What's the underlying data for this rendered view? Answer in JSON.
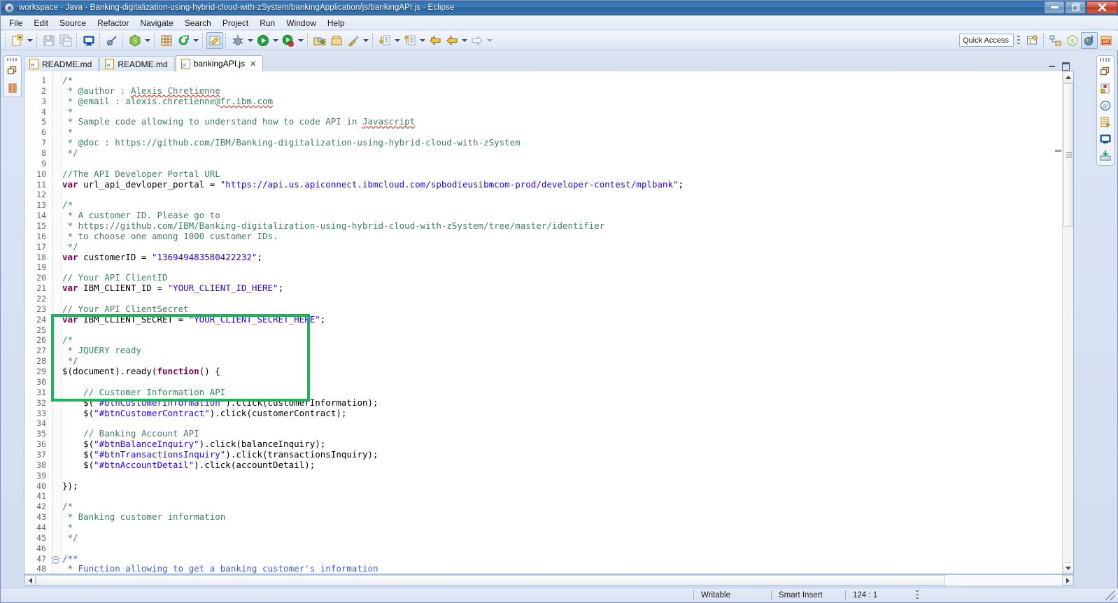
{
  "window": {
    "title": "workspace - Java - Banking-digitalization-using-hybrid-cloud-with-zSystem/bankingApplication/js/bankingAPI.js - Eclipse",
    "minimize_label": "—",
    "maximize_label": "❐",
    "close_label": "✕"
  },
  "menubar": {
    "items": [
      {
        "label": "File"
      },
      {
        "label": "Edit"
      },
      {
        "label": "Source"
      },
      {
        "label": "Refactor"
      },
      {
        "label": "Navigate"
      },
      {
        "label": "Search"
      },
      {
        "label": "Project"
      },
      {
        "label": "Run"
      },
      {
        "label": "Window"
      },
      {
        "label": "Help"
      }
    ]
  },
  "toolbar": {
    "quick_access_placeholder": "Quick Access",
    "buttons": [
      {
        "name": "new-wizard-icon",
        "title": "New"
      },
      {
        "name": "save-icon",
        "title": "Save"
      },
      {
        "name": "save-all-icon",
        "title": "Save All"
      },
      {
        "name": "console-icon",
        "title": "Open Console"
      },
      {
        "name": "skip-breakpoints-icon",
        "title": "Skip All Breakpoints"
      },
      {
        "name": "node-js-icon",
        "title": "Run Node.js"
      },
      {
        "name": "new-package-icon",
        "title": "New Java Package"
      },
      {
        "name": "refresh-icon",
        "title": "Refresh"
      },
      {
        "name": "marker-icon",
        "title": "Toggle Mark Occurrences"
      },
      {
        "name": "debug-icon",
        "title": "Debug"
      },
      {
        "name": "run-icon",
        "title": "Run"
      },
      {
        "name": "coverage-icon",
        "title": "Coverage"
      },
      {
        "name": "open-type-icon",
        "title": "Open Type"
      },
      {
        "name": "open-task-icon",
        "title": "Open Task"
      },
      {
        "name": "external-tools-icon",
        "title": "External Tools"
      },
      {
        "name": "next-annotation-icon",
        "title": "Next Annotation"
      },
      {
        "name": "previous-annotation-icon",
        "title": "Previous Annotation"
      },
      {
        "name": "back-icon",
        "title": "Back"
      },
      {
        "name": "forward-icon",
        "title": "Forward"
      }
    ],
    "perspectives": [
      {
        "name": "open-perspective-icon",
        "title": "Open Perspective"
      },
      {
        "name": "java-ee-perspective-icon",
        "title": "Java EE"
      },
      {
        "name": "javascript-perspective-icon",
        "title": "JavaScript"
      },
      {
        "name": "java-perspective-icon",
        "title": "Java",
        "active": true
      },
      {
        "name": "git-perspective-icon",
        "title": "Git"
      }
    ]
  },
  "left_shelf": {
    "items": [
      {
        "name": "restore-icon",
        "title": "Restore"
      },
      {
        "name": "package-explorer-icon",
        "title": "Package Explorer"
      }
    ]
  },
  "right_shelf": {
    "items": [
      {
        "name": "restore-icon",
        "title": "Restore"
      },
      {
        "name": "problems-icon",
        "title": "Problems"
      },
      {
        "name": "javadoc-icon",
        "title": "Javadoc"
      },
      {
        "name": "declaration-icon",
        "title": "Declaration"
      },
      {
        "name": "console-icon",
        "title": "Console"
      },
      {
        "name": "servers-icon",
        "title": "Servers"
      }
    ]
  },
  "editor": {
    "tabs": [
      {
        "label": "README.md",
        "icon": "markdown-file-icon",
        "active": false,
        "closable": false
      },
      {
        "label": "README.md",
        "icon": "markdown-file-icon",
        "active": false,
        "closable": false
      },
      {
        "label": "bankingAPI.js",
        "icon": "javascript-file-icon",
        "active": true,
        "closable": true,
        "close_label": "✕"
      }
    ],
    "minimize_title": "Minimize",
    "maximize_title": "Maximize",
    "highlight_color": "#19b559",
    "lines": [
      {
        "n": 1,
        "fold": false,
        "tokens": [
          {
            "c": "cmt",
            "t": "/*"
          }
        ]
      },
      {
        "n": 2,
        "fold": false,
        "tokens": [
          {
            "c": "cmt",
            "t": " * @author : "
          },
          {
            "c": "cmt spell",
            "t": "Alexis Chretienne"
          }
        ]
      },
      {
        "n": 3,
        "fold": false,
        "tokens": [
          {
            "c": "cmt",
            "t": " * @email : alexis.chretienne@"
          },
          {
            "c": "cmt spell",
            "t": "fr.ibm.com"
          }
        ]
      },
      {
        "n": 4,
        "fold": false,
        "tokens": [
          {
            "c": "cmt",
            "t": " *"
          }
        ]
      },
      {
        "n": 5,
        "fold": false,
        "tokens": [
          {
            "c": "cmt",
            "t": " * Sample code allowing to understand how to code API in "
          },
          {
            "c": "cmt spell",
            "t": "Javascript"
          }
        ]
      },
      {
        "n": 6,
        "fold": false,
        "tokens": [
          {
            "c": "cmt",
            "t": " *"
          }
        ]
      },
      {
        "n": 7,
        "fold": false,
        "tokens": [
          {
            "c": "cmt",
            "t": " * @doc : https://github.com/IBM/Banking-digitalization-using-hybrid-cloud-with-zSystem"
          }
        ]
      },
      {
        "n": 8,
        "fold": false,
        "tokens": [
          {
            "c": "cmt",
            "t": " */"
          }
        ]
      },
      {
        "n": 9,
        "fold": false,
        "tokens": []
      },
      {
        "n": 10,
        "fold": false,
        "tokens": [
          {
            "c": "cmt",
            "t": "//The API Developer Portal URL"
          }
        ]
      },
      {
        "n": 11,
        "fold": false,
        "tokens": [
          {
            "c": "kw",
            "t": "var"
          },
          {
            "c": "plain",
            "t": " url_api_devloper_portal = "
          },
          {
            "c": "str",
            "t": "\"https://api.us.apiconnect.ibmcloud.com/spbodieusibmcom-prod/developer-contest/mplbank\""
          },
          {
            "c": "plain",
            "t": ";"
          }
        ]
      },
      {
        "n": 12,
        "fold": false,
        "tokens": []
      },
      {
        "n": 13,
        "fold": false,
        "tokens": [
          {
            "c": "cmt",
            "t": "/*"
          }
        ]
      },
      {
        "n": 14,
        "fold": false,
        "tokens": [
          {
            "c": "cmt",
            "t": " * A customer ID. Please go to"
          }
        ]
      },
      {
        "n": 15,
        "fold": false,
        "tokens": [
          {
            "c": "cmt",
            "t": " * https://github.com/IBM/Banking-digitalization-using-hybrid-cloud-with-zSystem/tree/master/identifier"
          }
        ]
      },
      {
        "n": 16,
        "fold": false,
        "tokens": [
          {
            "c": "cmt",
            "t": " * to choose one among 1000 customer IDs."
          }
        ]
      },
      {
        "n": 17,
        "fold": false,
        "tokens": [
          {
            "c": "cmt",
            "t": " */"
          }
        ]
      },
      {
        "n": 18,
        "fold": false,
        "tokens": [
          {
            "c": "kw",
            "t": "var"
          },
          {
            "c": "plain",
            "t": " customerID = "
          },
          {
            "c": "str",
            "t": "\"136949483580422232\""
          },
          {
            "c": "plain",
            "t": ";"
          }
        ]
      },
      {
        "n": 19,
        "fold": false,
        "tokens": []
      },
      {
        "n": 20,
        "fold": false,
        "tokens": [
          {
            "c": "cmt",
            "t": "// Your API ClientID"
          }
        ]
      },
      {
        "n": 21,
        "fold": false,
        "tokens": [
          {
            "c": "kw",
            "t": "var"
          },
          {
            "c": "plain",
            "t": " IBM_CLIENT_ID = "
          },
          {
            "c": "str",
            "t": "\"YOUR_CLIENT_ID_HERE\""
          },
          {
            "c": "plain",
            "t": ";"
          }
        ]
      },
      {
        "n": 22,
        "fold": false,
        "tokens": []
      },
      {
        "n": 23,
        "fold": false,
        "tokens": [
          {
            "c": "cmt",
            "t": "// Your API ClientSecret"
          }
        ]
      },
      {
        "n": 24,
        "fold": false,
        "tokens": [
          {
            "c": "kw",
            "t": "var"
          },
          {
            "c": "plain",
            "t": " IBM_CLIENT_SECRET = "
          },
          {
            "c": "str",
            "t": "\"YOUR_CLIENT_SECRET_HERE\""
          },
          {
            "c": "plain",
            "t": ";"
          }
        ]
      },
      {
        "n": 25,
        "fold": false,
        "tokens": []
      },
      {
        "n": 26,
        "fold": false,
        "tokens": [
          {
            "c": "cmt",
            "t": "/*"
          }
        ]
      },
      {
        "n": 27,
        "fold": false,
        "tokens": [
          {
            "c": "cmt",
            "t": " * JQUERY ready"
          }
        ]
      },
      {
        "n": 28,
        "fold": false,
        "tokens": [
          {
            "c": "cmt",
            "t": " */"
          }
        ]
      },
      {
        "n": 29,
        "fold": false,
        "tokens": [
          {
            "c": "plain",
            "t": "$(document).ready("
          },
          {
            "c": "kw",
            "t": "function"
          },
          {
            "c": "plain",
            "t": "() {"
          }
        ]
      },
      {
        "n": 30,
        "fold": false,
        "tokens": []
      },
      {
        "n": 31,
        "fold": false,
        "tokens": [
          {
            "c": "cmt",
            "t": "    // Customer Information API"
          }
        ]
      },
      {
        "n": 32,
        "fold": false,
        "tokens": [
          {
            "c": "plain",
            "t": "    $("
          },
          {
            "c": "str",
            "t": "\"#btnCustomerInformation\""
          },
          {
            "c": "plain",
            "t": ").click(customerInformation);"
          }
        ]
      },
      {
        "n": 33,
        "fold": false,
        "tokens": [
          {
            "c": "plain",
            "t": "    $("
          },
          {
            "c": "str",
            "t": "\"#btnCustomerContract\""
          },
          {
            "c": "plain",
            "t": ").click(customerContract);"
          }
        ]
      },
      {
        "n": 34,
        "fold": false,
        "tokens": []
      },
      {
        "n": 35,
        "fold": false,
        "tokens": [
          {
            "c": "cmt",
            "t": "    // Banking Account API"
          }
        ]
      },
      {
        "n": 36,
        "fold": false,
        "tokens": [
          {
            "c": "plain",
            "t": "    $("
          },
          {
            "c": "str",
            "t": "\"#btnBalanceInquiry\""
          },
          {
            "c": "plain",
            "t": ").click(balanceInquiry);"
          }
        ]
      },
      {
        "n": 37,
        "fold": false,
        "tokens": [
          {
            "c": "plain",
            "t": "    $("
          },
          {
            "c": "str",
            "t": "\"#btnTransactionsInquiry\""
          },
          {
            "c": "plain",
            "t": ").click(transactionsInquiry);"
          }
        ]
      },
      {
        "n": 38,
        "fold": false,
        "tokens": [
          {
            "c": "plain",
            "t": "    $("
          },
          {
            "c": "str",
            "t": "\"#btnAccountDetail\""
          },
          {
            "c": "plain",
            "t": ").click(accountDetail);"
          }
        ]
      },
      {
        "n": 39,
        "fold": false,
        "tokens": []
      },
      {
        "n": 40,
        "fold": false,
        "tokens": [
          {
            "c": "plain",
            "t": "});"
          }
        ]
      },
      {
        "n": 41,
        "fold": false,
        "tokens": []
      },
      {
        "n": 42,
        "fold": false,
        "tokens": [
          {
            "c": "cmt",
            "t": "/*"
          }
        ]
      },
      {
        "n": 43,
        "fold": false,
        "tokens": [
          {
            "c": "cmt",
            "t": " * Banking customer information"
          }
        ]
      },
      {
        "n": 44,
        "fold": false,
        "tokens": [
          {
            "c": "cmt",
            "t": " *"
          }
        ]
      },
      {
        "n": 45,
        "fold": false,
        "tokens": [
          {
            "c": "cmt",
            "t": " */"
          }
        ]
      },
      {
        "n": 46,
        "fold": false,
        "tokens": []
      },
      {
        "n": 47,
        "fold": true,
        "tokens": [
          {
            "c": "jdoc",
            "t": "/**"
          }
        ]
      },
      {
        "n": 48,
        "fold": false,
        "tokens": [
          {
            "c": "jdoc",
            "t": " * Function allowing to get a banking customer's information"
          }
        ]
      }
    ]
  },
  "statusbar": {
    "writable": "Writable",
    "insert_mode": "Smart Insert",
    "cursor_position": "124 : 1"
  }
}
